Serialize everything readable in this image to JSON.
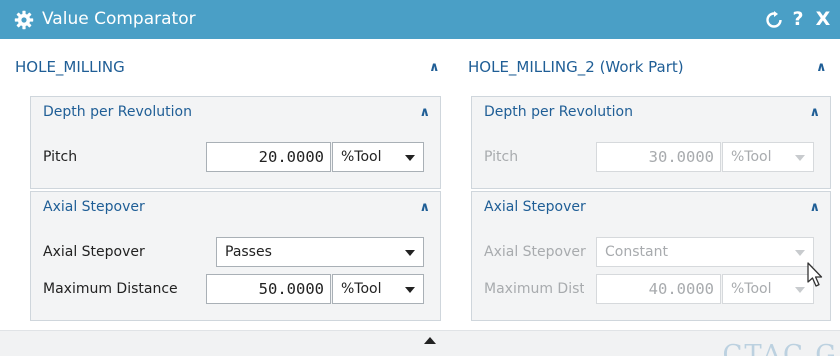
{
  "window": {
    "title": "Value Comparator",
    "reset_icon": "reset-icon",
    "help_label": "?",
    "close_label": "X",
    "accent_color": "#4a9fc6"
  },
  "left": {
    "title": "HOLE_MILLING",
    "depth_group": {
      "title": "Depth per Revolution",
      "pitch_label": "Pitch",
      "pitch_value": "20.0000",
      "pitch_unit": "%Tool"
    },
    "stepover_group": {
      "title": "Axial Stepover",
      "stepover_label": "Axial Stepover",
      "stepover_value": "Passes",
      "maxdist_label": "Maximum Distance",
      "maxdist_value": "50.0000",
      "maxdist_unit": "%Tool"
    }
  },
  "right": {
    "title": "HOLE_MILLING_2 (Work Part)",
    "depth_group": {
      "title": "Depth per Revolution",
      "pitch_label": "Pitch",
      "pitch_value": "30.0000",
      "pitch_unit": "%Tool"
    },
    "stepover_group": {
      "title": "Axial Stepover",
      "stepover_label": "Axial Stepover",
      "stepover_value": "Constant",
      "maxdist_label": "Maximum Distance",
      "maxdist_value": "40.0000",
      "maxdist_unit": "%Tool"
    }
  },
  "watermark": "CTAC G"
}
